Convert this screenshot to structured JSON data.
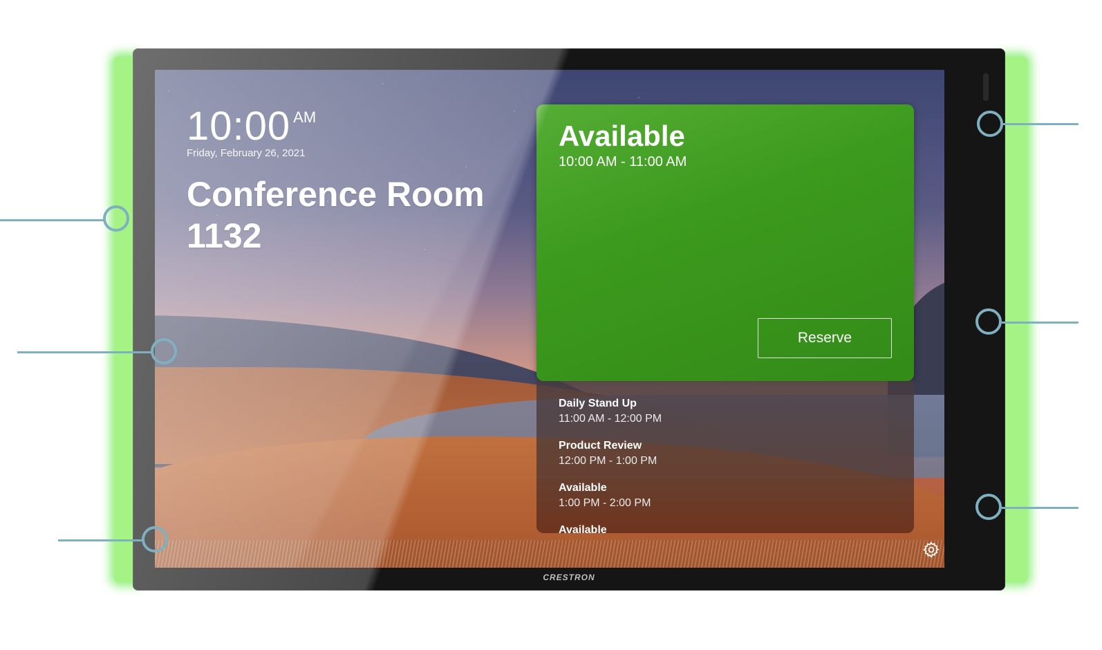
{
  "clock": {
    "time": "10:00",
    "ampm": "AM",
    "date": "Friday, February 26, 2021"
  },
  "room": {
    "name": "Conference Room 1132"
  },
  "status": {
    "title": "Available",
    "time_range": "10:00 AM - 11:00 AM",
    "reserve_label": "Reserve",
    "color": "#3c9a1d"
  },
  "schedule": [
    {
      "name": "Daily Stand Up",
      "time": "11:00 AM - 12:00 PM"
    },
    {
      "name": "Product Review",
      "time": "12:00 PM - 1:00 PM"
    },
    {
      "name": "Available",
      "time": "1:00 PM - 2:00 PM"
    },
    {
      "name": "Available",
      "time": ""
    }
  ],
  "device": {
    "brand": "CRESTRON",
    "led_color": "#58e63c",
    "callout_color": "#7fb0c0"
  },
  "icons": {
    "settings": "gear-icon"
  }
}
